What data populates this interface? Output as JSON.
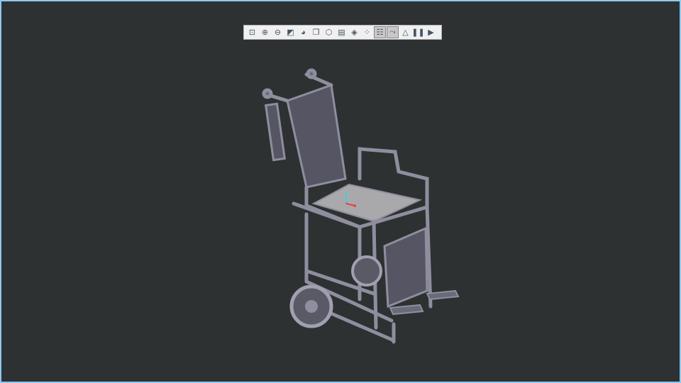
{
  "toolbar": {
    "buttons": [
      {
        "icon": "zoom-fit-icon",
        "glyph": "⊡",
        "active": false
      },
      {
        "icon": "zoom-in-icon",
        "glyph": "⊕",
        "active": false
      },
      {
        "icon": "zoom-out-icon",
        "glyph": "⊖",
        "active": false
      },
      {
        "icon": "normal-view-icon",
        "glyph": "◩",
        "active": false
      },
      {
        "icon": "shading-icon",
        "glyph": "◕",
        "active": false
      },
      {
        "icon": "view-cube-icon",
        "glyph": "❒",
        "active": false
      },
      {
        "icon": "iso-view-icon",
        "glyph": "⬡",
        "active": false
      },
      {
        "icon": "capture-icon",
        "glyph": "▤",
        "active": false
      },
      {
        "icon": "transparency-icon",
        "glyph": "◈",
        "active": false
      },
      {
        "icon": "explode-icon",
        "glyph": "⁘",
        "active": false
      },
      {
        "icon": "tree-icon",
        "glyph": "☷",
        "active": true
      },
      {
        "icon": "connections-icon",
        "glyph": "⤳",
        "active": true
      },
      {
        "icon": "hidden-icon",
        "glyph": "△",
        "active": false
      },
      {
        "icon": "pause-icon",
        "glyph": "❚❚",
        "active": false
      },
      {
        "icon": "next-icon",
        "glyph": "▶",
        "active": false
      }
    ]
  },
  "colors": {
    "background": "#2d3131",
    "border": "#8cc8f0",
    "frame": "#8a8a9a",
    "seat": "#a9a9ac"
  }
}
